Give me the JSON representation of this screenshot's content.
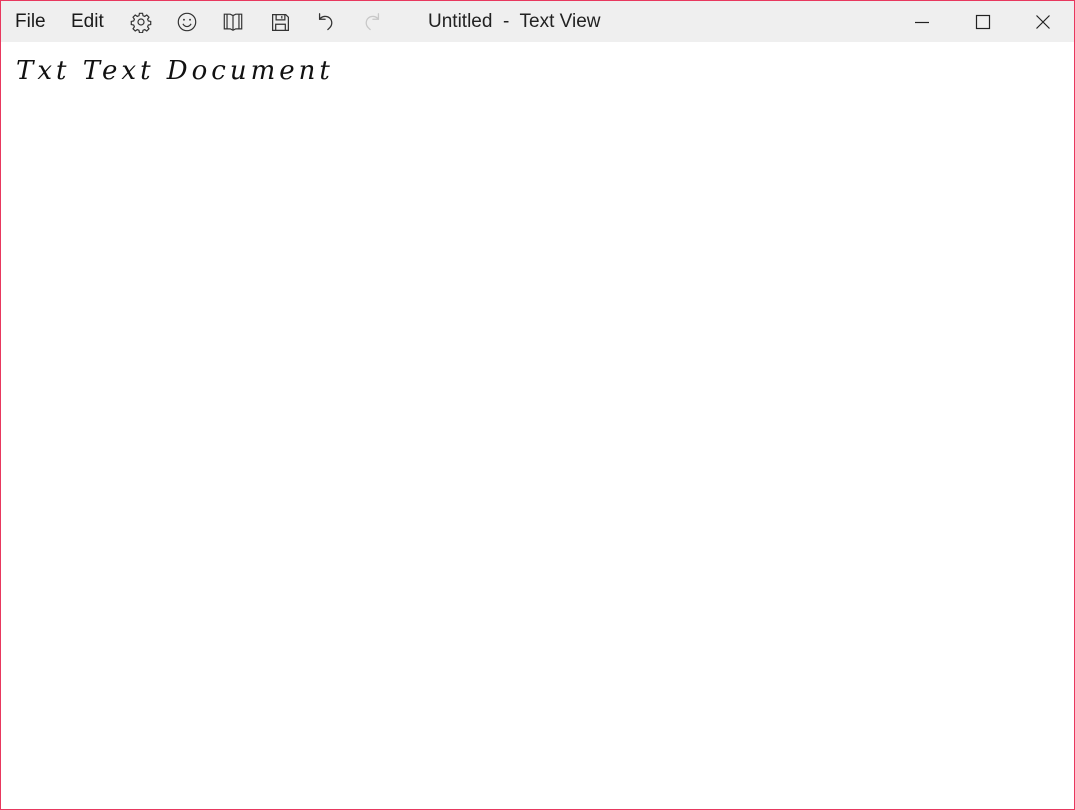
{
  "menu": {
    "file_label": "File",
    "edit_label": "Edit"
  },
  "toolbar": {
    "icons": [
      "settings-icon",
      "emoji-icon",
      "reading-view-icon",
      "save-icon",
      "undo-icon",
      "redo-icon"
    ],
    "redo_enabled": false
  },
  "window": {
    "title": "Untitled  -  Text View",
    "border_color": "#e8385e",
    "titlebar_color": "#efefef"
  },
  "editor": {
    "content": "Txt Text Document"
  }
}
